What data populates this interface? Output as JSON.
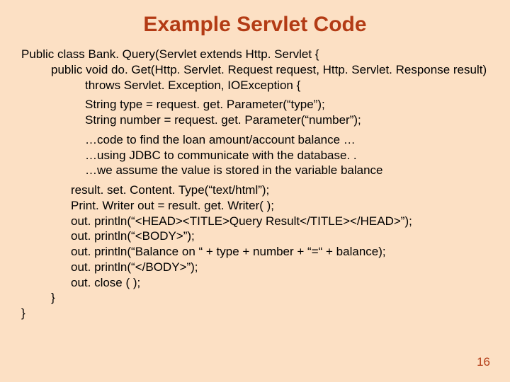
{
  "title": "Example Servlet Code",
  "code": {
    "l1": "Public class Bank. Query(Servlet extends Http. Servlet {",
    "l2": "public void do. Get(Http. Servlet. Request request, Http. Servlet. Response result)",
    "l3": "throws Servlet. Exception, IOException {",
    "l4": "String type = request. get. Parameter(“type”);",
    "l5": "String number = request. get. Parameter(“number”);",
    "l6": "…code to find the loan amount/account balance …",
    "l7": "…using JDBC to communicate with the database. .",
    "l8": "…we assume the value is stored in the variable balance",
    "l9": "result. set. Content. Type(“text/html”);",
    "l10": "Print. Writer out = result. get. Writer( );",
    "l11": "out. println(“<HEAD><TITLE>Query Result</TITLE></HEAD>”);",
    "l12": "out. println(“<BODY>”);",
    "l13": "out. println(“Balance on “ + type + number + “=“ + balance);",
    "l14": "out. println(“</BODY>”);",
    "l15": "out. close ( );",
    "l16": "}",
    "l17": "}"
  },
  "page_number": "16"
}
